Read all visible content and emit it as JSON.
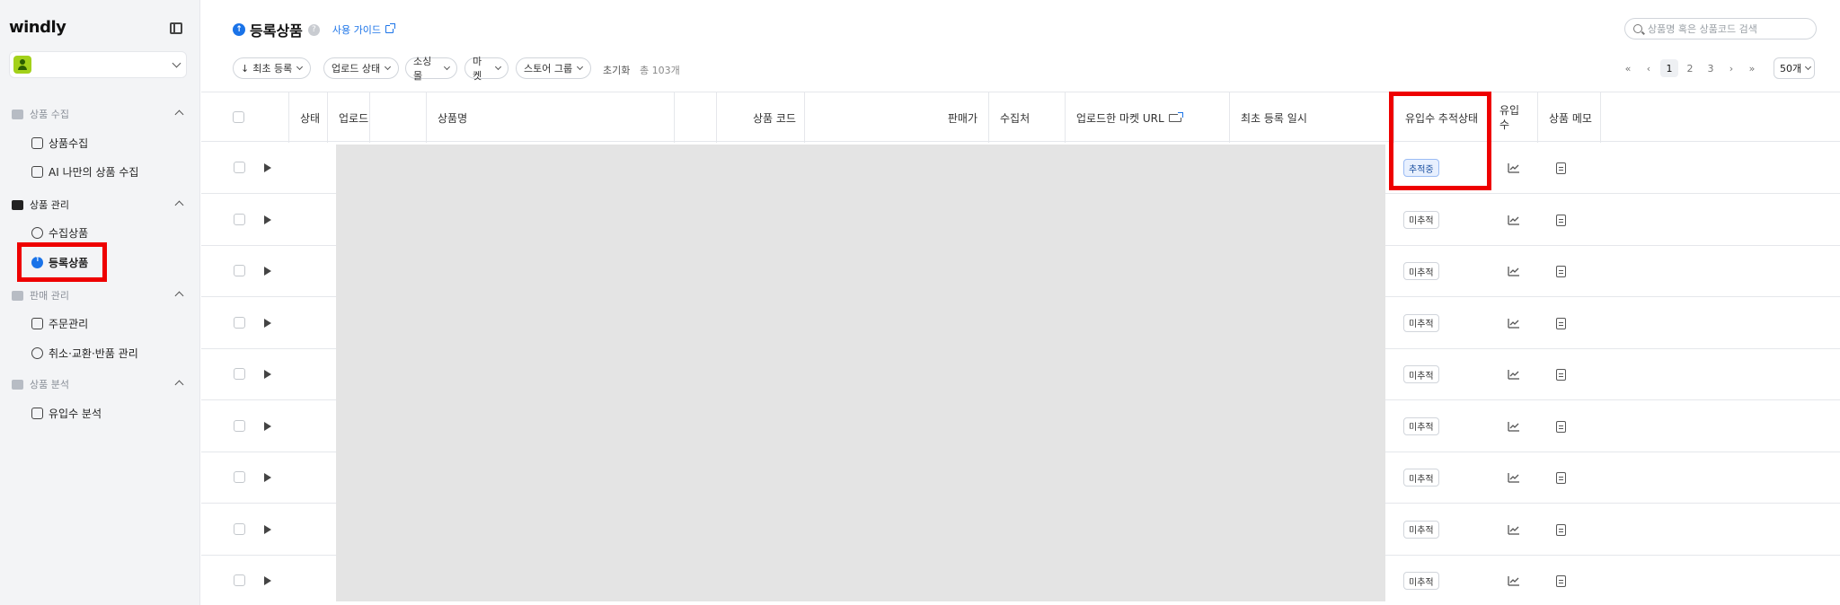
{
  "app": {
    "logo": "windly"
  },
  "sidebar": {
    "sections": [
      {
        "title": "상품 수집",
        "items": [
          "상품수집",
          "AI 나만의 상품 수집"
        ]
      },
      {
        "title": "상품 관리",
        "items": [
          "수집상품",
          "등록상품"
        ]
      },
      {
        "title": "판매 관리",
        "items": [
          "주문관리",
          "취소·교환·반품 관리"
        ]
      },
      {
        "title": "상품 분석",
        "items": [
          "유입수 분석"
        ]
      }
    ],
    "active_item": "등록상품"
  },
  "header": {
    "title": "등록상품",
    "help_symbol": "?",
    "guide_link": "사용 가이드",
    "search_placeholder": "상품명 혹은 상품코드 검색"
  },
  "filters": {
    "sort": "최초 등록",
    "upload_status": "업로드 상태",
    "source_mall": "소싱몰",
    "market": "마켓",
    "store_group": "스토어 그룹",
    "reset": "초기화",
    "total": "총 103개"
  },
  "pagination": {
    "first": "«",
    "prev": "‹",
    "pages": [
      "1",
      "2",
      "3"
    ],
    "current": "1",
    "next": "›",
    "last": "»",
    "page_size": "50개"
  },
  "table": {
    "columns": [
      "상태",
      "업로드",
      "상품명",
      "상품 코드",
      "판매가",
      "수집처",
      "업로드한 마켓 URL",
      "최초 등록 일시",
      "유입수 추적상태",
      "유입\n수",
      "상품 메모"
    ],
    "rows": [
      {
        "tracking_status": "추적중"
      },
      {
        "tracking_status": "미추적"
      },
      {
        "tracking_status": "미추적"
      },
      {
        "tracking_status": "미추적"
      },
      {
        "tracking_status": "미추적"
      },
      {
        "tracking_status": "미추적"
      },
      {
        "tracking_status": "미추적"
      },
      {
        "tracking_status": "미추적"
      },
      {
        "tracking_status": "미추적"
      }
    ]
  },
  "colors": {
    "accent": "#1a73e8",
    "highlight": "#ee0000",
    "avatar": "#a3d11a"
  }
}
